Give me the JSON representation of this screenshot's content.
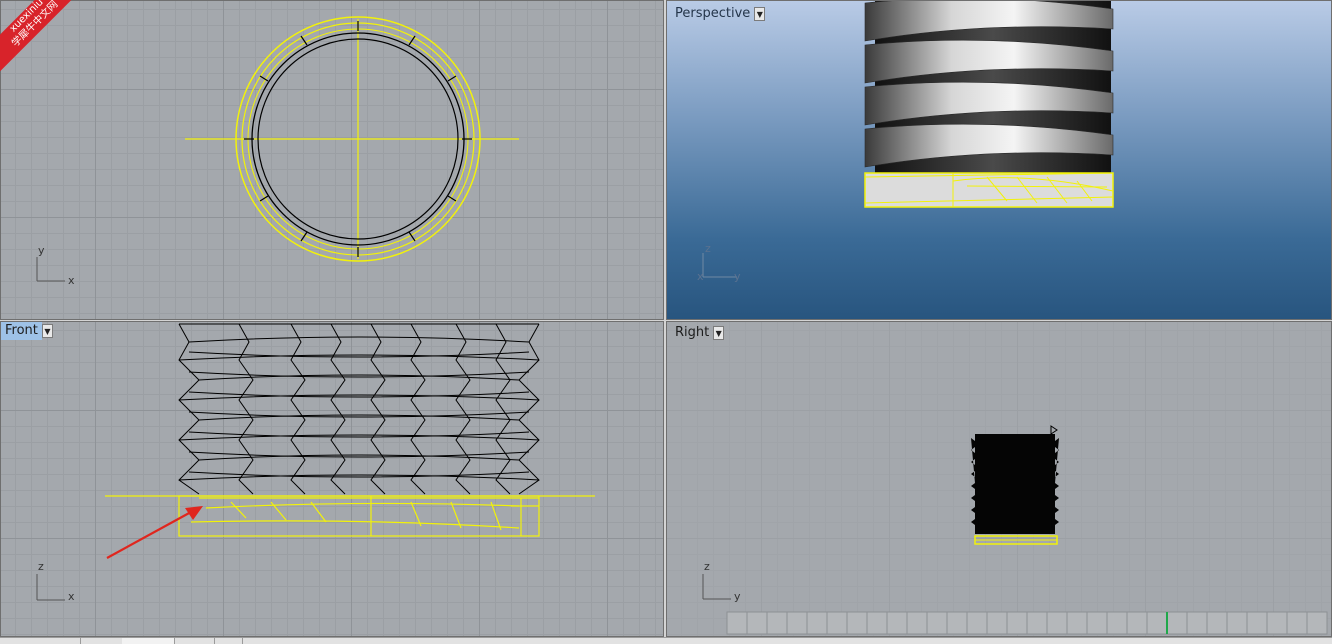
{
  "watermark": {
    "line1": "xuexiniu",
    "line2": "学犀牛中文网"
  },
  "viewports": {
    "top": {
      "axis_y": "y",
      "axis_x": "x"
    },
    "perspective": {
      "label": "Perspective",
      "axis_z": "z",
      "axis_x": "x",
      "axis_y": "y"
    },
    "front": {
      "label": "Front",
      "axis_z": "z",
      "axis_x": "x"
    },
    "right": {
      "label": "Right",
      "axis_z": "z",
      "axis_y": "y"
    }
  },
  "dropdown_icon": "chevron-down-icon",
  "colors": {
    "selection": "#f2f20a",
    "wire": "#000000",
    "annotation_arrow": "#e0261e",
    "active_label": "#9ec2e7"
  }
}
